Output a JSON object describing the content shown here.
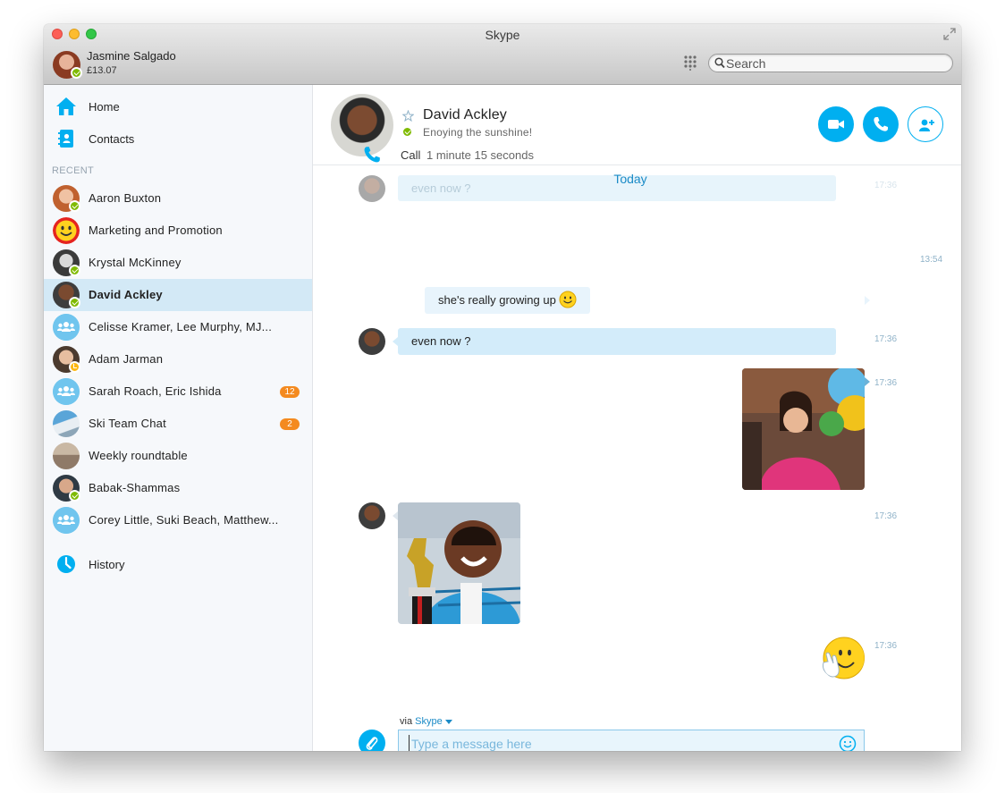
{
  "window": {
    "title": "Skype"
  },
  "account": {
    "name": "Jasmine Salgado",
    "credit": "£13.07"
  },
  "search": {
    "placeholder": "Search"
  },
  "nav": {
    "home": "Home",
    "contacts": "Contacts",
    "history": "History"
  },
  "recent": {
    "header": "RECENT",
    "items": [
      {
        "label": "Aaron Buxton",
        "status": "online"
      },
      {
        "label": "Marketing and Promotion"
      },
      {
        "label": "Krystal McKinney",
        "status": "online"
      },
      {
        "label": "David Ackley",
        "status": "online",
        "active": true
      },
      {
        "label": "Celisse Kramer, Lee Murphy, MJ..."
      },
      {
        "label": "Adam Jarman",
        "status": "away"
      },
      {
        "label": "Sarah Roach, Eric Ishida",
        "badge": "12"
      },
      {
        "label": "Ski Team Chat",
        "badge": "2"
      },
      {
        "label": "Weekly roundtable"
      },
      {
        "label": "Babak-Shammas",
        "status": "online"
      },
      {
        "label": "Corey Little, Suki Beach, Matthew..."
      }
    ]
  },
  "contact": {
    "name": "David Ackley",
    "mood": "Enoying the sunshine!"
  },
  "conversation": {
    "day_label": "Today",
    "faded_message": "even now ?",
    "faded_time": "17:36",
    "call": {
      "label": "Call",
      "duration": "1 minute 15 seconds",
      "time": "13:54"
    },
    "messages": [
      {
        "text": "she's really growing up",
        "time": ""
      },
      {
        "text": "even now ?",
        "time": "17:36"
      }
    ],
    "photo_mine_time": "17:36",
    "photo_theirs_time": "17:36",
    "emoticon_time": "17:36"
  },
  "composer": {
    "via_prefix": "via",
    "via_service": "Skype",
    "placeholder": "Type a message here"
  },
  "colors": {
    "accent": "#00aff0",
    "online": "#7fba00",
    "away": "#fdb813",
    "badge": "#f48a1f",
    "selected": "#d3e9f6",
    "bubble": "#d3ecfa"
  }
}
